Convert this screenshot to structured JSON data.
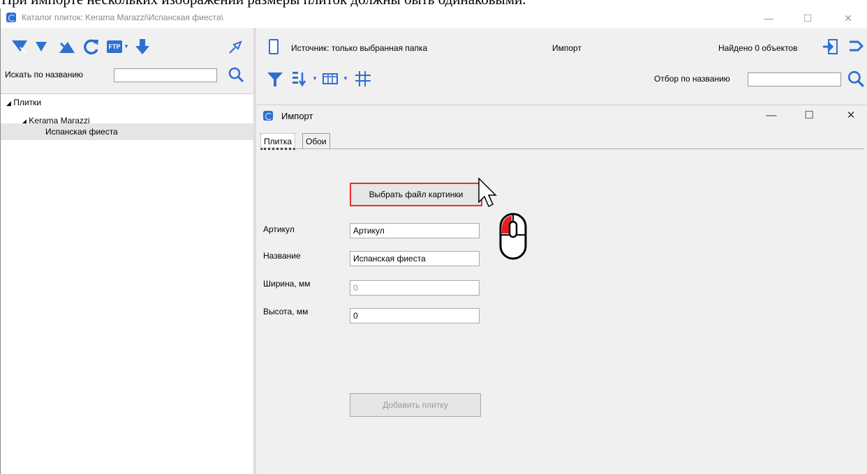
{
  "caption": "При импорте нескольких изображений размеры плиток должны быть одинаковыми.",
  "window": {
    "title": "Каталог плиток: Kerama Marazzi\\Испанская фиеста\\",
    "minimize": "—",
    "maximize": "☐",
    "close": "✕"
  },
  "left": {
    "toolbar": {
      "ftp_label": "FTP"
    },
    "search_label": "Искать по названию",
    "search_value": "",
    "tree": [
      {
        "label": "Плитки",
        "arrow": "◢"
      },
      {
        "label": "Kerama Marazzi",
        "arrow": "◢"
      },
      {
        "label": "Испанская фиеста",
        "arrow": ""
      }
    ]
  },
  "right": {
    "source": "Источник: только выбранная папка",
    "import": "Импорт",
    "found": "Найдено 0 объектов",
    "filter_label": "Отбор по названию",
    "filter_value": ""
  },
  "dialog": {
    "title": "Импорт",
    "minimize": "—",
    "maximize": "☐",
    "close": "✕",
    "tabs": [
      {
        "label": "Плитка",
        "active": true
      },
      {
        "label": "Обои",
        "active": false
      }
    ],
    "pick_button": "Выбрать файл картинки",
    "fields": [
      {
        "label": "Артикул",
        "value": "Артикул",
        "disabled": false
      },
      {
        "label": "Название",
        "value": "Испанская фиеста",
        "disabled": false
      },
      {
        "label": "Ширина, мм",
        "value": "0",
        "disabled": true
      },
      {
        "label": "Высота, мм",
        "value": "0",
        "disabled": false
      }
    ],
    "add_button": "Добавить плитку"
  },
  "colors": {
    "accent": "#2e6fd2",
    "highlight_border": "#e53030",
    "mouse_button": "#e02020"
  },
  "icons": [
    "filter-down-icon",
    "filter-icon",
    "filter-up-icon",
    "refresh-icon",
    "ftp-icon",
    "download-icon",
    "pin-icon",
    "search-icon",
    "document-icon",
    "import-icon",
    "export-icon",
    "funnel-icon",
    "sort-icon",
    "grid-icon",
    "table-icon",
    "cursor-icon",
    "mouse-left-click-icon"
  ]
}
